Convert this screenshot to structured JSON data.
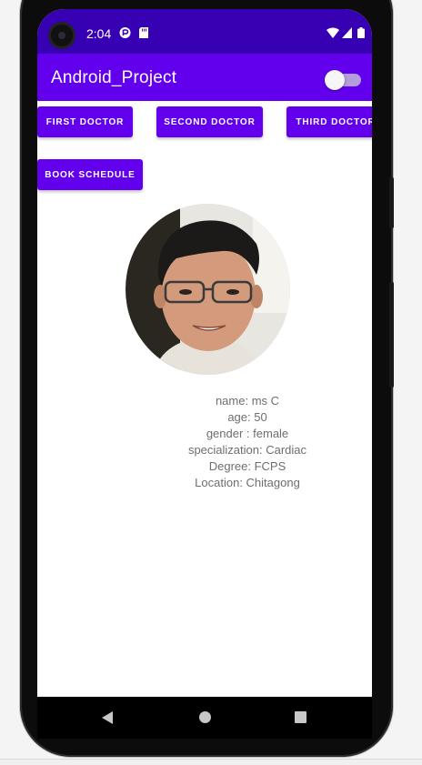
{
  "status_bar": {
    "time": "2:04",
    "icons": [
      "camera-cutout-icon",
      "play-protect-icon",
      "sd-card-icon",
      "wifi-icon",
      "signal-icon",
      "battery-icon"
    ]
  },
  "app_bar": {
    "title": "Android_Project",
    "toggle_on": false
  },
  "buttons": {
    "first": "FIRST DOCTOR",
    "second": "SECOND DOCTOR",
    "third": "THIRD DOCTOR",
    "book": "BOOK SCHEDULE"
  },
  "doctor": {
    "name": "name: ms C",
    "age": "age: 50",
    "gender": "gender : female",
    "specialization": "specialization: Cardiac",
    "degree": "Degree: FCPS",
    "location": "Location: Chitagong"
  },
  "nav": {
    "icons": [
      "back-icon",
      "home-icon",
      "recents-icon"
    ]
  },
  "colors": {
    "primary": "#6200ee",
    "primary_dark": "#3700b3",
    "text_secondary": "#6e6e6e"
  }
}
